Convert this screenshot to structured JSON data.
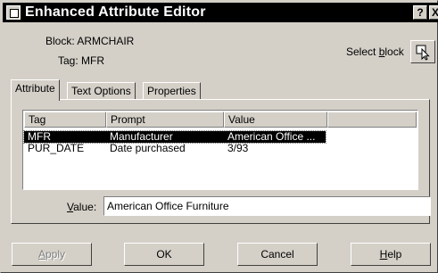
{
  "window": {
    "title": "Enhanced Attribute Editor",
    "help_button": "?",
    "close_button": "X"
  },
  "info": {
    "block": "Block: ARMCHAIR",
    "tag": "Tag: MFR"
  },
  "select_block": {
    "label_prefix": "Select ",
    "label_accel": "b",
    "label_suffix": "lock",
    "icon": "select-object-cursor-icon"
  },
  "tabs": [
    {
      "label": "Attribute",
      "active": true
    },
    {
      "label": "Text Options",
      "active": false
    },
    {
      "label": "Properties",
      "active": false
    }
  ],
  "table": {
    "columns": [
      "Tag",
      "Prompt",
      "Value"
    ],
    "rows": [
      {
        "tag": "MFR",
        "prompt": "Manufacturer",
        "value": "American Office ...",
        "selected": true
      },
      {
        "tag": "PUR_DATE",
        "prompt": "Date purchased",
        "value": "3/93",
        "selected": false
      }
    ]
  },
  "value_field": {
    "label_accel": "V",
    "label_rest": "alue:",
    "value": "American Office Furniture"
  },
  "buttons": {
    "apply": {
      "accel": "A",
      "rest": "pply",
      "enabled": false
    },
    "ok": {
      "label": "OK"
    },
    "cancel": {
      "label": "Cancel"
    },
    "help": {
      "accel": "H",
      "rest": "elp"
    }
  }
}
